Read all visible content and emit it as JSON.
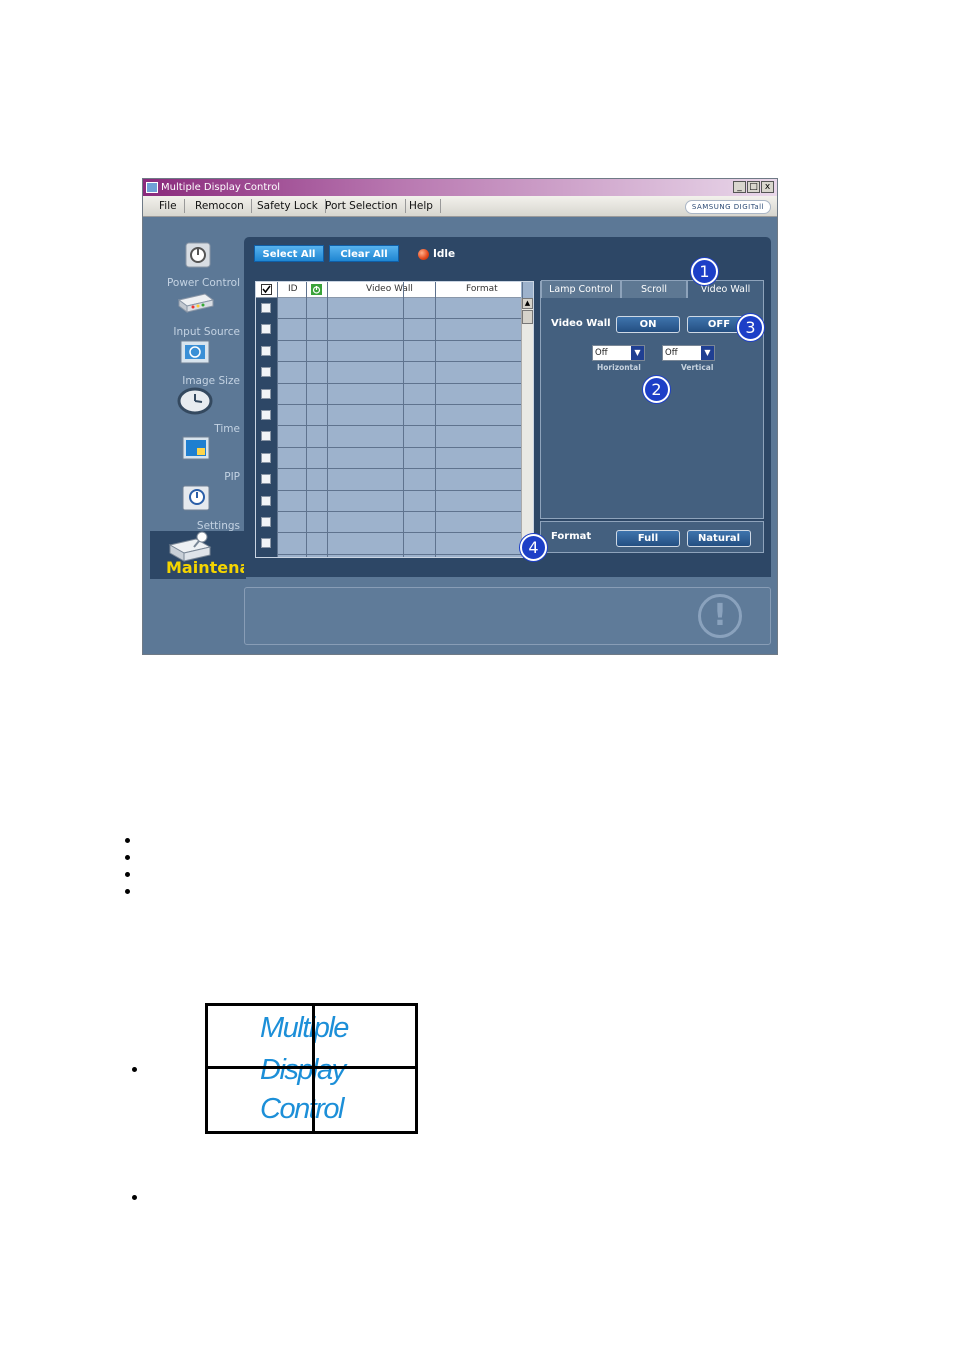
{
  "window": {
    "title": "Multiple Display Control",
    "controls": [
      "_",
      "□",
      "x"
    ],
    "brand": "SAMSUNG DIGITall"
  },
  "menu": [
    "File",
    "Remocon",
    "Safety Lock",
    "Port Selection",
    "Help"
  ],
  "nav": [
    {
      "label": "Power Control",
      "icon": "power-control-icon"
    },
    {
      "label": "Input Source",
      "icon": "input-source-icon"
    },
    {
      "label": "Image Size",
      "icon": "image-size-icon"
    },
    {
      "label": "Time",
      "icon": "clock-icon"
    },
    {
      "label": "PIP",
      "icon": "pip-icon"
    },
    {
      "label": "Settings",
      "icon": "settings-icon"
    },
    {
      "label": "Maintenance",
      "icon": "maintenance-icon"
    }
  ],
  "toolbar": {
    "select_all": "Select All",
    "clear_all": "Clear All",
    "status": "Idle"
  },
  "table": {
    "columns": [
      "ID",
      "Video Wall",
      "Format"
    ],
    "row_count": 12
  },
  "tabs": [
    "Lamp Control",
    "Scroll",
    "Video Wall"
  ],
  "video_wall": {
    "label": "Video Wall",
    "on": "ON",
    "off": "OFF",
    "horizontal": {
      "value": "Off",
      "label": "Horizontal"
    },
    "vertical": {
      "value": "Off",
      "label": "Vertical"
    }
  },
  "format": {
    "label": "Format",
    "full": "Full",
    "natural": "Natural"
  },
  "callouts": [
    "1",
    "2",
    "3",
    "4"
  ],
  "illustration": {
    "lines": [
      "Multiple",
      "Display",
      "Control"
    ]
  },
  "colors": {
    "accent": "#1f86d2",
    "panel": "#2d4766",
    "callout": "#1d3fc7",
    "wall_text": "#1c8fd8"
  }
}
